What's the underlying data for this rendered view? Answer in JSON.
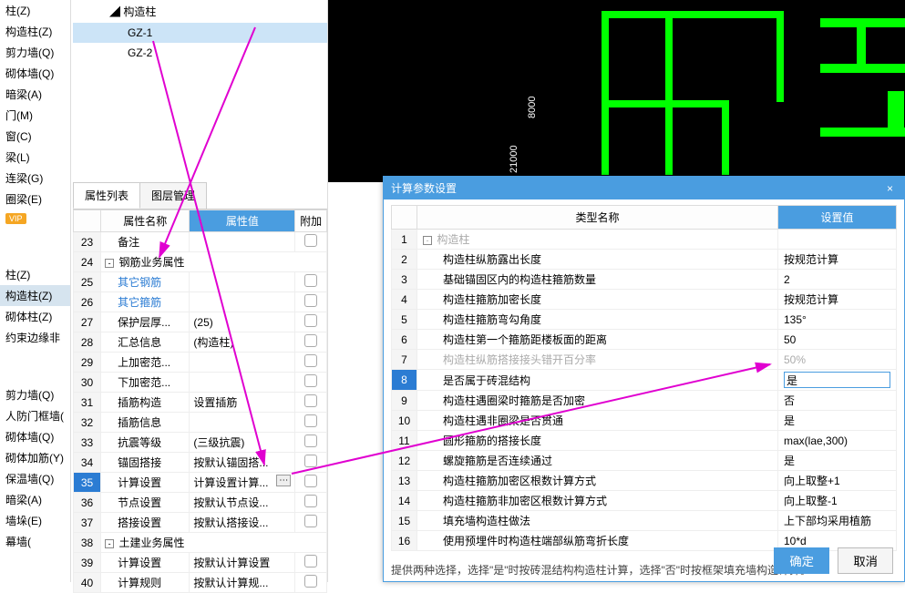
{
  "sidebar1": {
    "items_top": [
      {
        "label": "柱(Z)"
      },
      {
        "label": "构造柱(Z)"
      },
      {
        "label": "剪力墙(Q)"
      },
      {
        "label": "砌体墙(Q)"
      },
      {
        "label": "暗梁(A)"
      },
      {
        "label": "门(M)"
      },
      {
        "label": "窗(C)"
      },
      {
        "label": "梁(L)"
      },
      {
        "label": "连梁(G)"
      },
      {
        "label": "圈梁(E)"
      }
    ],
    "vip": "VIP",
    "items_mid": [
      {
        "label": "柱(Z)"
      },
      {
        "label": "构造柱(Z)",
        "selected": true
      },
      {
        "label": "砌体柱(Z)"
      },
      {
        "label": "约束边缘非"
      }
    ],
    "items_bot": [
      {
        "label": "剪力墙(Q)"
      },
      {
        "label": "人防门框墙("
      },
      {
        "label": "砌体墙(Q)"
      },
      {
        "label": "砌体加筋(Y)"
      },
      {
        "label": "保温墙(Q)"
      },
      {
        "label": "暗梁(A)"
      },
      {
        "label": "墙垛(E)"
      },
      {
        "label": "幕墙("
      }
    ]
  },
  "tree": {
    "parent": "构造柱",
    "children": [
      {
        "label": "GZ-1",
        "selected": true
      },
      {
        "label": "GZ-2"
      }
    ]
  },
  "prop_panel": {
    "tabs": [
      "属性列表",
      "图层管理"
    ],
    "headers": {
      "name": "属性名称",
      "value": "属性值",
      "extra": "附加"
    },
    "rows": [
      {
        "n": "23",
        "name": "备注",
        "value": "",
        "chk": false
      },
      {
        "n": "24",
        "name": "钢筋业务属性",
        "value": "",
        "group": true
      },
      {
        "n": "25",
        "name": "其它钢筋",
        "value": "",
        "link": true,
        "chk": false
      },
      {
        "n": "26",
        "name": "其它箍筋",
        "value": "",
        "link": true,
        "chk": false
      },
      {
        "n": "27",
        "name": "保护层厚...",
        "value": "(25)",
        "chk": true
      },
      {
        "n": "28",
        "name": "汇总信息",
        "value": "(构造柱)",
        "chk": false
      },
      {
        "n": "29",
        "name": "上加密范...",
        "value": "",
        "chk": false
      },
      {
        "n": "30",
        "name": "下加密范...",
        "value": "",
        "chk": false
      },
      {
        "n": "31",
        "name": "插筋构造",
        "value": "设置插筋",
        "chk": false
      },
      {
        "n": "32",
        "name": "插筋信息",
        "value": "",
        "chk": false
      },
      {
        "n": "33",
        "name": "抗震等级",
        "value": "(三级抗震)",
        "chk": false
      },
      {
        "n": "34",
        "name": "锚固搭接",
        "value": "按默认锚固搭...",
        "chk": false
      },
      {
        "n": "35",
        "name": "计算设置",
        "value": "计算设置计算...",
        "chk": false,
        "sel": true,
        "btn": true
      },
      {
        "n": "36",
        "name": "节点设置",
        "value": "按默认节点设...",
        "chk": false
      },
      {
        "n": "37",
        "name": "搭接设置",
        "value": "按默认搭接设...",
        "chk": false
      },
      {
        "n": "38",
        "name": "土建业务属性",
        "value": "",
        "group": true
      },
      {
        "n": "39",
        "name": "计算设置",
        "value": "按默认计算设置",
        "chk": false
      },
      {
        "n": "40",
        "name": "计算规则",
        "value": "按默认计算规...",
        "chk": false
      }
    ]
  },
  "viewport": {
    "dims": [
      "8000",
      "21000"
    ]
  },
  "dialog": {
    "title": "计算参数设置",
    "headers": {
      "name": "类型名称",
      "value": "设置值"
    },
    "rows": [
      {
        "n": "1",
        "name": "构造柱",
        "value": "",
        "group": true
      },
      {
        "n": "2",
        "name": "构造柱纵筋露出长度",
        "value": "按规范计算"
      },
      {
        "n": "3",
        "name": "基础锚固区内的构造柱箍筋数量",
        "value": "2"
      },
      {
        "n": "4",
        "name": "构造柱箍筋加密长度",
        "value": "按规范计算"
      },
      {
        "n": "5",
        "name": "构造柱箍筋弯勾角度",
        "value": "135°"
      },
      {
        "n": "6",
        "name": "构造柱第一个箍筋距楼板面的距离",
        "value": "50"
      },
      {
        "n": "7",
        "name": "构造柱纵筋搭接接头错开百分率",
        "value": "50%",
        "disabled": true
      },
      {
        "n": "8",
        "name": "是否属于砖混结构",
        "value": "是",
        "sel": true
      },
      {
        "n": "9",
        "name": "构造柱遇圈梁时箍筋是否加密",
        "value": "否"
      },
      {
        "n": "10",
        "name": "构造柱遇非圈梁是否贯通",
        "value": "是"
      },
      {
        "n": "11",
        "name": "圆形箍筋的搭接长度",
        "value": "max(lae,300)"
      },
      {
        "n": "12",
        "name": "螺旋箍筋是否连续通过",
        "value": "是"
      },
      {
        "n": "13",
        "name": "构造柱箍筋加密区根数计算方式",
        "value": "向上取整+1"
      },
      {
        "n": "14",
        "name": "构造柱箍筋非加密区根数计算方式",
        "value": "向上取整-1"
      },
      {
        "n": "15",
        "name": "填充墙构造柱做法",
        "value": "上下部均采用植筋"
      },
      {
        "n": "16",
        "name": "使用预埋件时构造柱端部纵筋弯折长度",
        "value": "10*d"
      }
    ],
    "hint": "提供两种选择，选择\"是\"时按砖混结构构造柱计算，选择\"否\"时按框架填充墙构造计算。",
    "ok": "确定",
    "cancel": "取消"
  }
}
